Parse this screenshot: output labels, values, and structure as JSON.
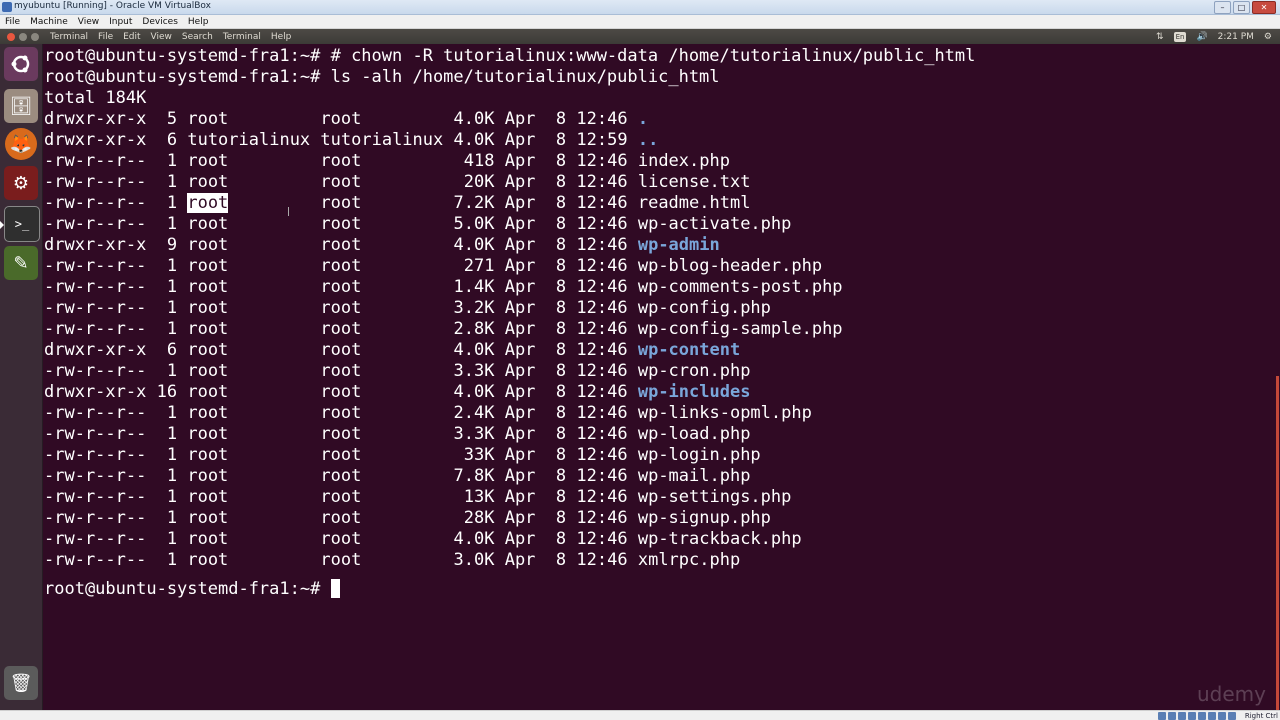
{
  "vbox": {
    "title": "myubuntu [Running] - Oracle VM VirtualBox",
    "menu": [
      "File",
      "Machine",
      "View",
      "Input",
      "Devices",
      "Help"
    ],
    "host_key": "Right Ctrl"
  },
  "panel": {
    "menu": [
      "Terminal",
      "File",
      "Edit",
      "View",
      "Search",
      "Terminal",
      "Help"
    ],
    "keyboard": "En",
    "volume": "🔊",
    "time": "2:21 PM",
    "gear": "⚙"
  },
  "launcher": {
    "icons": {
      "dash": "dash-home-icon",
      "files": "files-icon",
      "firefox": "firefox-icon",
      "settings": "system-settings-icon",
      "terminal": "terminal-icon",
      "editor": "text-editor-icon",
      "trash": "trash-icon"
    }
  },
  "terminal": {
    "prompt": "root@ubuntu-systemd-fra1:~#",
    "cmd1": "# chown -R tutorialinux:www-data /home/tutorialinux/public_html",
    "cmd2": "ls -alh /home/tutorialinux/public_html",
    "total": "total 184K",
    "colors": {
      "background": "#300a24",
      "foreground": "#ffffff",
      "directory": "#7aa6da"
    },
    "rows": [
      {
        "perm": "drwxr-xr-x",
        "links": "5",
        "owner": "root",
        "group": "root",
        "size": "4.0K",
        "month": "Apr",
        "day": "8",
        "time": "12:46",
        "name": ".",
        "dir": true
      },
      {
        "perm": "drwxr-xr-x",
        "links": "6",
        "owner": "tutorialinux",
        "group": "tutorialinux",
        "size": "4.0K",
        "month": "Apr",
        "day": "8",
        "time": "12:59",
        "name": "..",
        "dir": true
      },
      {
        "perm": "-rw-r--r--",
        "links": "1",
        "owner": "root",
        "group": "root",
        "size": "418",
        "month": "Apr",
        "day": "8",
        "time": "12:46",
        "name": "index.php",
        "dir": false
      },
      {
        "perm": "-rw-r--r--",
        "links": "1",
        "owner": "root",
        "group": "root",
        "size": "20K",
        "month": "Apr",
        "day": "8",
        "time": "12:46",
        "name": "license.txt",
        "dir": false
      },
      {
        "perm": "-rw-r--r--",
        "links": "1",
        "owner": "root",
        "group": "root",
        "size": "7.2K",
        "month": "Apr",
        "day": "8",
        "time": "12:46",
        "name": "readme.html",
        "dir": false,
        "selected_owner": true
      },
      {
        "perm": "-rw-r--r--",
        "links": "1",
        "owner": "root",
        "group": "root",
        "size": "5.0K",
        "month": "Apr",
        "day": "8",
        "time": "12:46",
        "name": "wp-activate.php",
        "dir": false
      },
      {
        "perm": "drwxr-xr-x",
        "links": "9",
        "owner": "root",
        "group": "root",
        "size": "4.0K",
        "month": "Apr",
        "day": "8",
        "time": "12:46",
        "name": "wp-admin",
        "dir": true
      },
      {
        "perm": "-rw-r--r--",
        "links": "1",
        "owner": "root",
        "group": "root",
        "size": "271",
        "month": "Apr",
        "day": "8",
        "time": "12:46",
        "name": "wp-blog-header.php",
        "dir": false
      },
      {
        "perm": "-rw-r--r--",
        "links": "1",
        "owner": "root",
        "group": "root",
        "size": "1.4K",
        "month": "Apr",
        "day": "8",
        "time": "12:46",
        "name": "wp-comments-post.php",
        "dir": false
      },
      {
        "perm": "-rw-r--r--",
        "links": "1",
        "owner": "root",
        "group": "root",
        "size": "3.2K",
        "month": "Apr",
        "day": "8",
        "time": "12:46",
        "name": "wp-config.php",
        "dir": false
      },
      {
        "perm": "-rw-r--r--",
        "links": "1",
        "owner": "root",
        "group": "root",
        "size": "2.8K",
        "month": "Apr",
        "day": "8",
        "time": "12:46",
        "name": "wp-config-sample.php",
        "dir": false
      },
      {
        "perm": "drwxr-xr-x",
        "links": "6",
        "owner": "root",
        "group": "root",
        "size": "4.0K",
        "month": "Apr",
        "day": "8",
        "time": "12:46",
        "name": "wp-content",
        "dir": true
      },
      {
        "perm": "-rw-r--r--",
        "links": "1",
        "owner": "root",
        "group": "root",
        "size": "3.3K",
        "month": "Apr",
        "day": "8",
        "time": "12:46",
        "name": "wp-cron.php",
        "dir": false
      },
      {
        "perm": "drwxr-xr-x",
        "links": "16",
        "owner": "root",
        "group": "root",
        "size": "4.0K",
        "month": "Apr",
        "day": "8",
        "time": "12:46",
        "name": "wp-includes",
        "dir": true
      },
      {
        "perm": "-rw-r--r--",
        "links": "1",
        "owner": "root",
        "group": "root",
        "size": "2.4K",
        "month": "Apr",
        "day": "8",
        "time": "12:46",
        "name": "wp-links-opml.php",
        "dir": false
      },
      {
        "perm": "-rw-r--r--",
        "links": "1",
        "owner": "root",
        "group": "root",
        "size": "3.3K",
        "month": "Apr",
        "day": "8",
        "time": "12:46",
        "name": "wp-load.php",
        "dir": false
      },
      {
        "perm": "-rw-r--r--",
        "links": "1",
        "owner": "root",
        "group": "root",
        "size": "33K",
        "month": "Apr",
        "day": "8",
        "time": "12:46",
        "name": "wp-login.php",
        "dir": false
      },
      {
        "perm": "-rw-r--r--",
        "links": "1",
        "owner": "root",
        "group": "root",
        "size": "7.8K",
        "month": "Apr",
        "day": "8",
        "time": "12:46",
        "name": "wp-mail.php",
        "dir": false
      },
      {
        "perm": "-rw-r--r--",
        "links": "1",
        "owner": "root",
        "group": "root",
        "size": "13K",
        "month": "Apr",
        "day": "8",
        "time": "12:46",
        "name": "wp-settings.php",
        "dir": false
      },
      {
        "perm": "-rw-r--r--",
        "links": "1",
        "owner": "root",
        "group": "root",
        "size": "28K",
        "month": "Apr",
        "day": "8",
        "time": "12:46",
        "name": "wp-signup.php",
        "dir": false
      },
      {
        "perm": "-rw-r--r--",
        "links": "1",
        "owner": "root",
        "group": "root",
        "size": "4.0K",
        "month": "Apr",
        "day": "8",
        "time": "12:46",
        "name": "wp-trackback.php",
        "dir": false
      },
      {
        "perm": "-rw-r--r--",
        "links": "1",
        "owner": "root",
        "group": "root",
        "size": "3.0K",
        "month": "Apr",
        "day": "8",
        "time": "12:46",
        "name": "xmlrpc.php",
        "dir": false
      }
    ]
  },
  "watermark": "udemy"
}
